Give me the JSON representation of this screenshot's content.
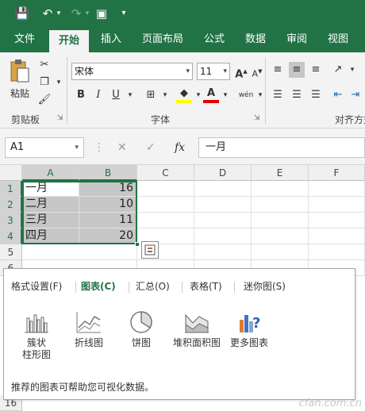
{
  "ribbon_tabs": [
    "文件",
    "开始",
    "插入",
    "页面布局",
    "公式",
    "数据",
    "审阅",
    "视图"
  ],
  "active_tab": "开始",
  "clipboard": {
    "paste_label": "粘贴",
    "group_label": "剪贴板"
  },
  "font": {
    "name": "宋体",
    "size": "11",
    "group_label": "字体",
    "bold": "B",
    "italic": "I",
    "underline": "U",
    "phonetic": "wén"
  },
  "alignment": {
    "group_label": "对齐方式"
  },
  "formula_bar": {
    "name_box": "A1",
    "fx": "fx",
    "formula": "一月"
  },
  "grid": {
    "columns": [
      "A",
      "B",
      "C",
      "D",
      "E",
      "F"
    ],
    "rows": [
      "1",
      "2",
      "3",
      "4",
      "5",
      "6",
      "16"
    ],
    "data": [
      {
        "label": "一月",
        "value": "16"
      },
      {
        "label": "二月",
        "value": "10"
      },
      {
        "label": "三月",
        "value": "11"
      },
      {
        "label": "四月",
        "value": "20"
      }
    ]
  },
  "quick_analysis": {
    "tabs": [
      "格式设置(F)",
      "图表(C)",
      "汇总(O)",
      "表格(T)",
      "迷你图(S)"
    ],
    "active_tab": "图表(C)",
    "items": [
      {
        "label": "簇状\n柱形图",
        "icon": "clustered-column-chart-icon"
      },
      {
        "label": "折线图",
        "icon": "line-chart-icon"
      },
      {
        "label": "饼图",
        "icon": "pie-chart-icon"
      },
      {
        "label": "堆积面积图",
        "icon": "stacked-area-chart-icon"
      },
      {
        "label": "更多图表",
        "icon": "more-charts-icon"
      }
    ],
    "hint": "推荐的图表可帮助您可视化数据。"
  },
  "watermark": "cfan.com.cn",
  "colors": {
    "brand": "#217346",
    "selection": "#c6c6c6"
  }
}
